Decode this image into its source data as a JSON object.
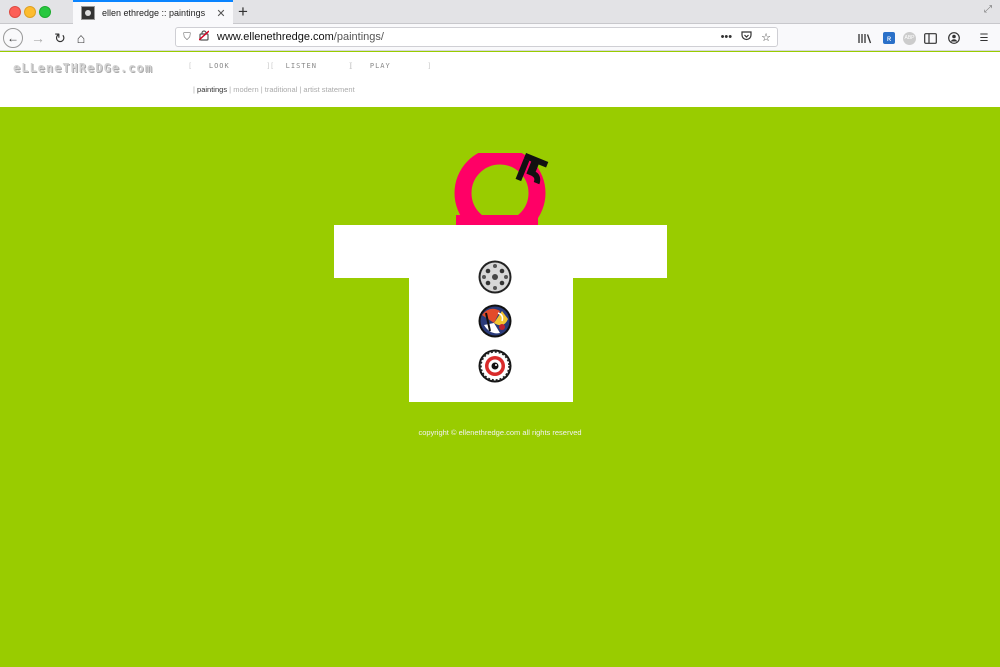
{
  "browser": {
    "tab": {
      "title": "ellen ethredge :: paintings",
      "close_glyph": "✕"
    },
    "new_tab_glyph": "+",
    "url": {
      "domain": "www.ellenethredge.com",
      "path": "/paintings/"
    },
    "icons": [
      "back-icon",
      "forward-icon",
      "reload-icon",
      "home-icon",
      "shield-icon",
      "insecure-lock-icon",
      "more-icon",
      "pocket-icon",
      "bookmark-star-icon",
      "library-icon",
      "extension-icon",
      "adblock-icon",
      "reader-icon",
      "account-icon",
      "menu-icon"
    ]
  },
  "site": {
    "logo": "eLLeneTHReDGe.com",
    "nav": [
      {
        "label": "LOOK"
      },
      {
        "label": "LISTEN"
      },
      {
        "label": "PLAY"
      }
    ],
    "subnav": [
      {
        "label": "paintings",
        "active": true
      },
      {
        "label": "modern",
        "active": false
      },
      {
        "label": "traditional",
        "active": false
      },
      {
        "label": "artist statement",
        "active": false
      }
    ],
    "copyright": "copyright © ellenethredge.com all rights reserved"
  },
  "colors": {
    "background": "#99cc00",
    "magenta": "#ff0066",
    "shirt": "#ffffff"
  }
}
